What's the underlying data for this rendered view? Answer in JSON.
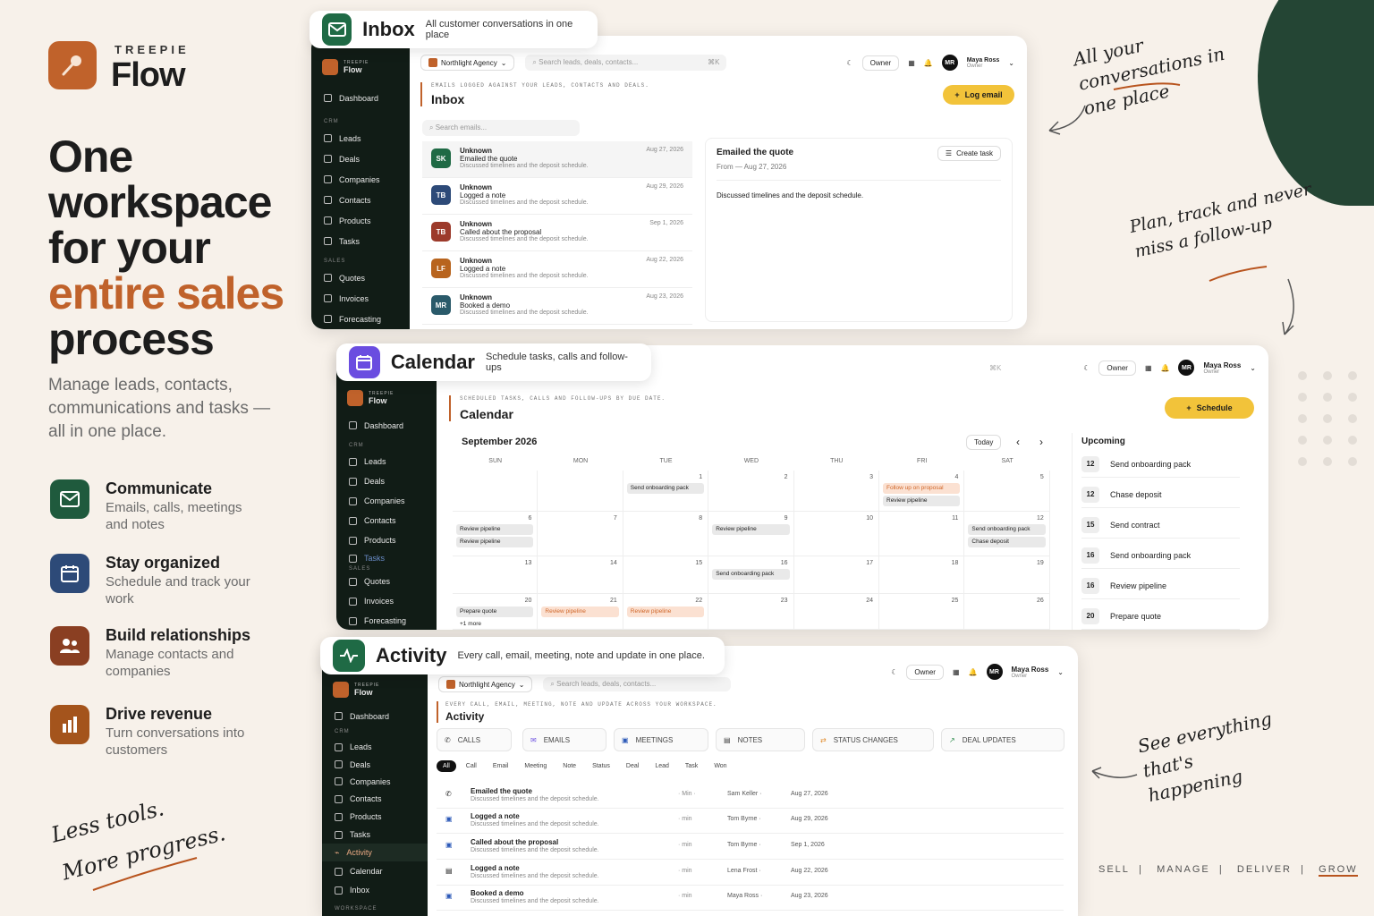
{
  "brand": {
    "small": "TREEPIE",
    "big": "Flow"
  },
  "headline": {
    "line1": "One workspace for your",
    "highlight": "entire sales",
    "line3": "process"
  },
  "subtitle": "Manage leads, contacts, communications and tasks — all in one place.",
  "features": [
    {
      "title": "Communicate",
      "desc": "Emails, calls, meetings and notes",
      "icon": "mail-icon",
      "color": "#1f5a3d"
    },
    {
      "title": "Stay organized",
      "desc": "Schedule and track your work",
      "icon": "calendar-icon",
      "color": "#2d4a78"
    },
    {
      "title": "Build relationships",
      "desc": "Manage contacts and companies",
      "icon": "users-icon",
      "color": "#8a3f22"
    },
    {
      "title": "Drive revenue",
      "desc": "Turn conversations into customers",
      "icon": "bar-chart-icon",
      "color": "#a4541c"
    }
  ],
  "handwriting": {
    "top_right": "All your conversations in one place",
    "mid_right": "Plan, track and never miss a follow-up",
    "bottom_right": "See everything that's happening",
    "bottom_left_1": "Less tools.",
    "bottom_left_2": "More progress."
  },
  "tagline": {
    "w1": "SELL",
    "w2": "MANAGE",
    "w3": "DELIVER",
    "w4": "GROW",
    "sep": "|"
  },
  "common": {
    "sb_brand_small": "TREEPIE",
    "sb_brand_big": "Flow",
    "agency": "Northlight Agency",
    "search_placeholder": "Search leads, deals, contacts...",
    "shortcut": "⌘K",
    "owner_btn": "Owner",
    "user_initials": "MR",
    "user_name": "Maya Ross",
    "user_role": "Owner",
    "sec_crm": "CRM",
    "sec_sales": "SALES",
    "sec_workspace": "WORKSPACE",
    "nav": {
      "dashboard": "Dashboard",
      "leads": "Leads",
      "deals": "Deals",
      "companies": "Companies",
      "contacts": "Contacts",
      "products": "Products",
      "tasks": "Tasks",
      "quotes": "Quotes",
      "invoices": "Invoices",
      "forecasting": "Forecasting",
      "activity": "Activity",
      "calendar": "Calendar",
      "inbox": "Inbox"
    }
  },
  "inbox": {
    "tab_title": "Inbox",
    "tab_desc": "All customer conversations in one place",
    "eyebrow": "EMAILS LOGGED AGAINST YOUR LEADS, CONTACTS AND DEALS.",
    "title": "Inbox",
    "log_btn": "Log email",
    "search_placeholder": "Search emails...",
    "rows": [
      {
        "initials": "SK",
        "color": "#1f6a45",
        "who": "Unknown",
        "subject": "Emailed the quote",
        "preview": "Discussed timelines and the deposit schedule.",
        "date": "Aug 27, 2026"
      },
      {
        "initials": "TB",
        "color": "#2d4a78",
        "who": "Unknown",
        "subject": "Logged a note",
        "preview": "Discussed timelines and the deposit schedule.",
        "date": "Aug 29, 2026"
      },
      {
        "initials": "TB",
        "color": "#9c3a2b",
        "who": "Unknown",
        "subject": "Called about the proposal",
        "preview": "Discussed timelines and the deposit schedule.",
        "date": "Sep 1, 2026"
      },
      {
        "initials": "LF",
        "color": "#b8641e",
        "who": "Unknown",
        "subject": "Logged a note",
        "preview": "Discussed timelines and the deposit schedule.",
        "date": "Aug 22, 2026"
      },
      {
        "initials": "MR",
        "color": "#2a5a6a",
        "who": "Unknown",
        "subject": "Booked a demo",
        "preview": "Discussed timelines and the deposit schedule.",
        "date": "Aug 23, 2026"
      }
    ],
    "detail": {
      "subject": "Emailed the quote",
      "meta": "From — Aug 27, 2026",
      "create_task": "Create task",
      "body": "Discussed timelines and the deposit schedule."
    }
  },
  "calendar": {
    "tab_title": "Calendar",
    "tab_desc": "Schedule tasks, calls and follow-ups",
    "eyebrow": "SCHEDULED TASKS, CALLS AND FOLLOW-UPS BY DUE DATE.",
    "title": "Calendar",
    "schedule_btn": "Schedule",
    "month": "September 2026",
    "today_btn": "Today",
    "weekdays": [
      "SUN",
      "MON",
      "TUE",
      "WED",
      "THU",
      "FRI",
      "SAT"
    ],
    "days": [
      {
        "n": "",
        "ev": []
      },
      {
        "n": "",
        "ev": []
      },
      {
        "n": "1",
        "ev": [
          {
            "t": "Send onboarding pack",
            "o": false
          }
        ]
      },
      {
        "n": "2",
        "ev": []
      },
      {
        "n": "3",
        "ev": []
      },
      {
        "n": "4",
        "ev": [
          {
            "t": "Follow up on proposal",
            "o": true
          },
          {
            "t": "Review pipeline",
            "o": false
          }
        ]
      },
      {
        "n": "5",
        "ev": []
      },
      {
        "n": "6",
        "ev": [
          {
            "t": "Review pipeline",
            "o": false
          },
          {
            "t": "Review pipeline",
            "o": false
          }
        ]
      },
      {
        "n": "7",
        "ev": []
      },
      {
        "n": "8",
        "ev": []
      },
      {
        "n": "9",
        "ev": [
          {
            "t": "Review pipeline",
            "o": false
          }
        ]
      },
      {
        "n": "10",
        "ev": []
      },
      {
        "n": "11",
        "ev": []
      },
      {
        "n": "12",
        "ev": [
          {
            "t": "Send onboarding pack",
            "o": false
          },
          {
            "t": "Chase deposit",
            "o": false
          }
        ]
      },
      {
        "n": "13",
        "ev": []
      },
      {
        "n": "14",
        "ev": []
      },
      {
        "n": "15",
        "ev": []
      },
      {
        "n": "16",
        "ev": [
          {
            "t": "Send onboarding pack",
            "o": false
          }
        ]
      },
      {
        "n": "17",
        "ev": []
      },
      {
        "n": "18",
        "ev": []
      },
      {
        "n": "19",
        "ev": []
      },
      {
        "n": "20",
        "ev": [
          {
            "t": "Prepare quote",
            "o": false
          },
          {
            "t": "+1 more",
            "o": false
          }
        ]
      },
      {
        "n": "21",
        "ev": [
          {
            "t": "Review pipeline",
            "o": true
          }
        ]
      },
      {
        "n": "22",
        "ev": [
          {
            "t": "Review pipeline",
            "o": true
          }
        ]
      },
      {
        "n": "23",
        "ev": []
      },
      {
        "n": "24",
        "ev": []
      },
      {
        "n": "25",
        "ev": []
      },
      {
        "n": "26",
        "ev": []
      }
    ],
    "upcoming_title": "Upcoming",
    "upcoming": [
      {
        "d": "12",
        "t": "Send onboarding pack"
      },
      {
        "d": "12",
        "t": "Chase deposit"
      },
      {
        "d": "15",
        "t": "Send contract"
      },
      {
        "d": "16",
        "t": "Send onboarding pack"
      },
      {
        "d": "16",
        "t": "Review pipeline"
      },
      {
        "d": "20",
        "t": "Prepare quote"
      }
    ]
  },
  "activity": {
    "tab_title": "Activity",
    "tab_desc": "Every call, email, meeting, note and update in one place.",
    "eyebrow": "EVERY CALL, EMAIL, MEETING, NOTE AND UPDATE ACROSS YOUR WORKSPACE.",
    "title": "Activity",
    "types": [
      "CALLS",
      "EMAILS",
      "MEETINGS",
      "NOTES",
      "STATUS CHANGES",
      "DEAL UPDATES"
    ],
    "filters": [
      "All",
      "Call",
      "Email",
      "Meeting",
      "Note",
      "Status",
      "Deal",
      "Lead",
      "Task",
      "Won"
    ],
    "rows": [
      {
        "t1": "Emailed the quote",
        "t2": "Discussed timelines and the deposit schedule.",
        "m": "· Min ·",
        "w": "Sam Keller ·",
        "dt": "Aug 27, 2026",
        "icon": "phone-icon"
      },
      {
        "t1": "Logged a note",
        "t2": "Discussed timelines and the deposit schedule.",
        "m": "· min",
        "w": "Tom Byrne ·",
        "dt": "Aug 29, 2026",
        "icon": "calendar-icon"
      },
      {
        "t1": "Called about the proposal",
        "t2": "Discussed timelines and the deposit schedule.",
        "m": "· min",
        "w": "Tom Byrne ·",
        "dt": "Sep 1, 2026",
        "icon": "calendar-icon"
      },
      {
        "t1": "Logged a note",
        "t2": "Discussed timelines and the deposit schedule.",
        "m": "· min",
        "w": "Lena Frost ·",
        "dt": "Aug 22, 2026",
        "icon": "note-icon"
      },
      {
        "t1": "Booked a demo",
        "t2": "Discussed timelines and the deposit schedule.",
        "m": "· min",
        "w": "Maya Ross ·",
        "dt": "Aug 23, 2026",
        "icon": "calendar-icon"
      }
    ]
  }
}
